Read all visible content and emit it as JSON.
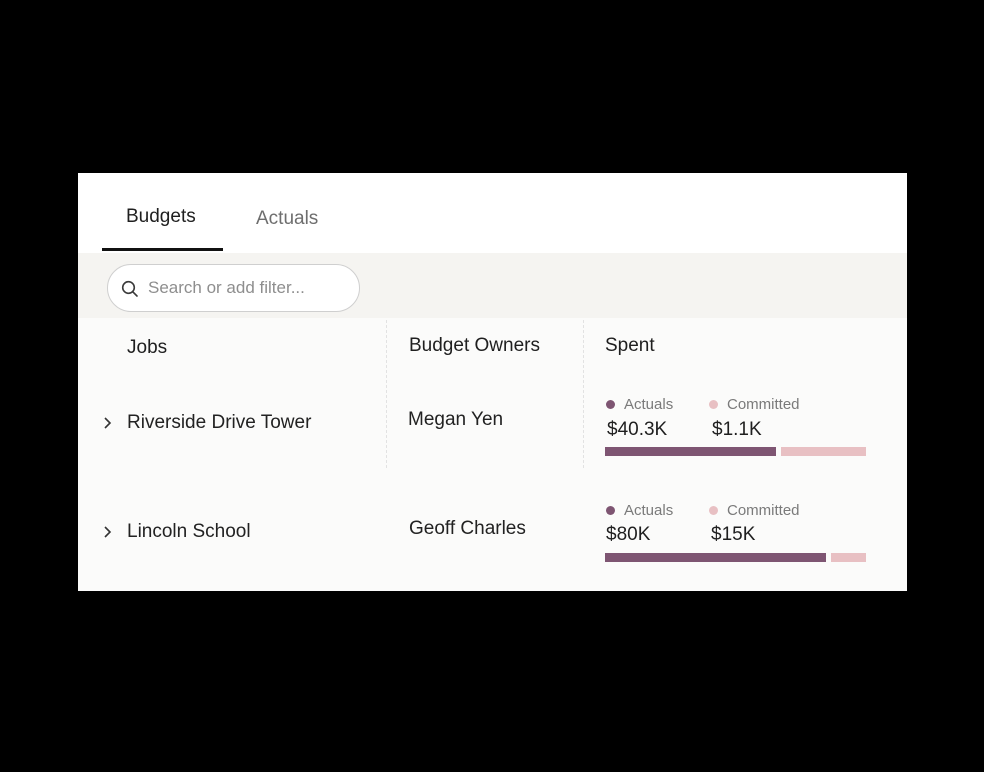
{
  "tabs": [
    {
      "label": "Budgets",
      "active": true
    },
    {
      "label": "Actuals",
      "active": false
    }
  ],
  "search": {
    "placeholder": "Search or add filter..."
  },
  "columns": {
    "jobs": "Jobs",
    "owners": "Budget Owners",
    "spent": "Spent"
  },
  "legend": {
    "actuals": "Actuals",
    "committed": "Committed"
  },
  "colors": {
    "actuals": "#7e5572",
    "committed": "#e8c0c3"
  },
  "rows": [
    {
      "job": "Riverside Drive Tower",
      "owner": "Megan Yen",
      "actuals": "$40.3K",
      "committed": "$1.1K",
      "actuals_fraction": 0.657,
      "committed_fraction": 0.327
    },
    {
      "job": "Lincoln School",
      "owner": "Geoff Charles",
      "actuals": "$80K",
      "committed": "$15K",
      "actuals_fraction": 0.85,
      "committed_fraction": 0.135
    }
  ]
}
